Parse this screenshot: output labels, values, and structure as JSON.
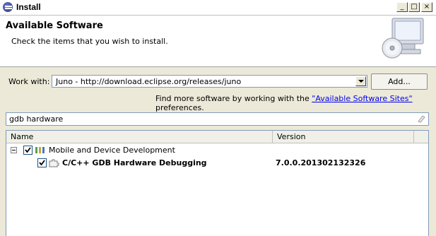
{
  "window": {
    "title": "Install",
    "controls": {
      "minimize": "_",
      "maximize": "□",
      "close": "×"
    }
  },
  "header": {
    "title": "Available Software",
    "description": "Check the items that you wish to install."
  },
  "work_with": {
    "label": "Work with:",
    "value": "Juno - http://download.eclipse.org/releases/juno",
    "add_label": "Add..."
  },
  "sites_note": {
    "prefix": "Find more software by working with the ",
    "link": "\"Available Software Sites\"",
    "suffix": " preferences."
  },
  "filter": {
    "value": "gdb hardware"
  },
  "table": {
    "columns": [
      "Name",
      "Version"
    ],
    "rows": [
      {
        "name": "Mobile and Device Development",
        "version": "",
        "checked": true,
        "expanded": true
      },
      {
        "name": "C/C++ GDB Hardware Debugging",
        "version": "7.0.0.201302132326",
        "checked": true
      }
    ]
  },
  "icons": {
    "app": "eclipse-install-icon",
    "banner": "install-cd-computer-icon",
    "category": "category-icon",
    "feature": "feature-plugin-icon",
    "clear": "clear-filter-icon"
  },
  "colors": {
    "link": "#0000ee",
    "header_bg": "#ffffff",
    "dialog_bg": "#ece9d8"
  }
}
